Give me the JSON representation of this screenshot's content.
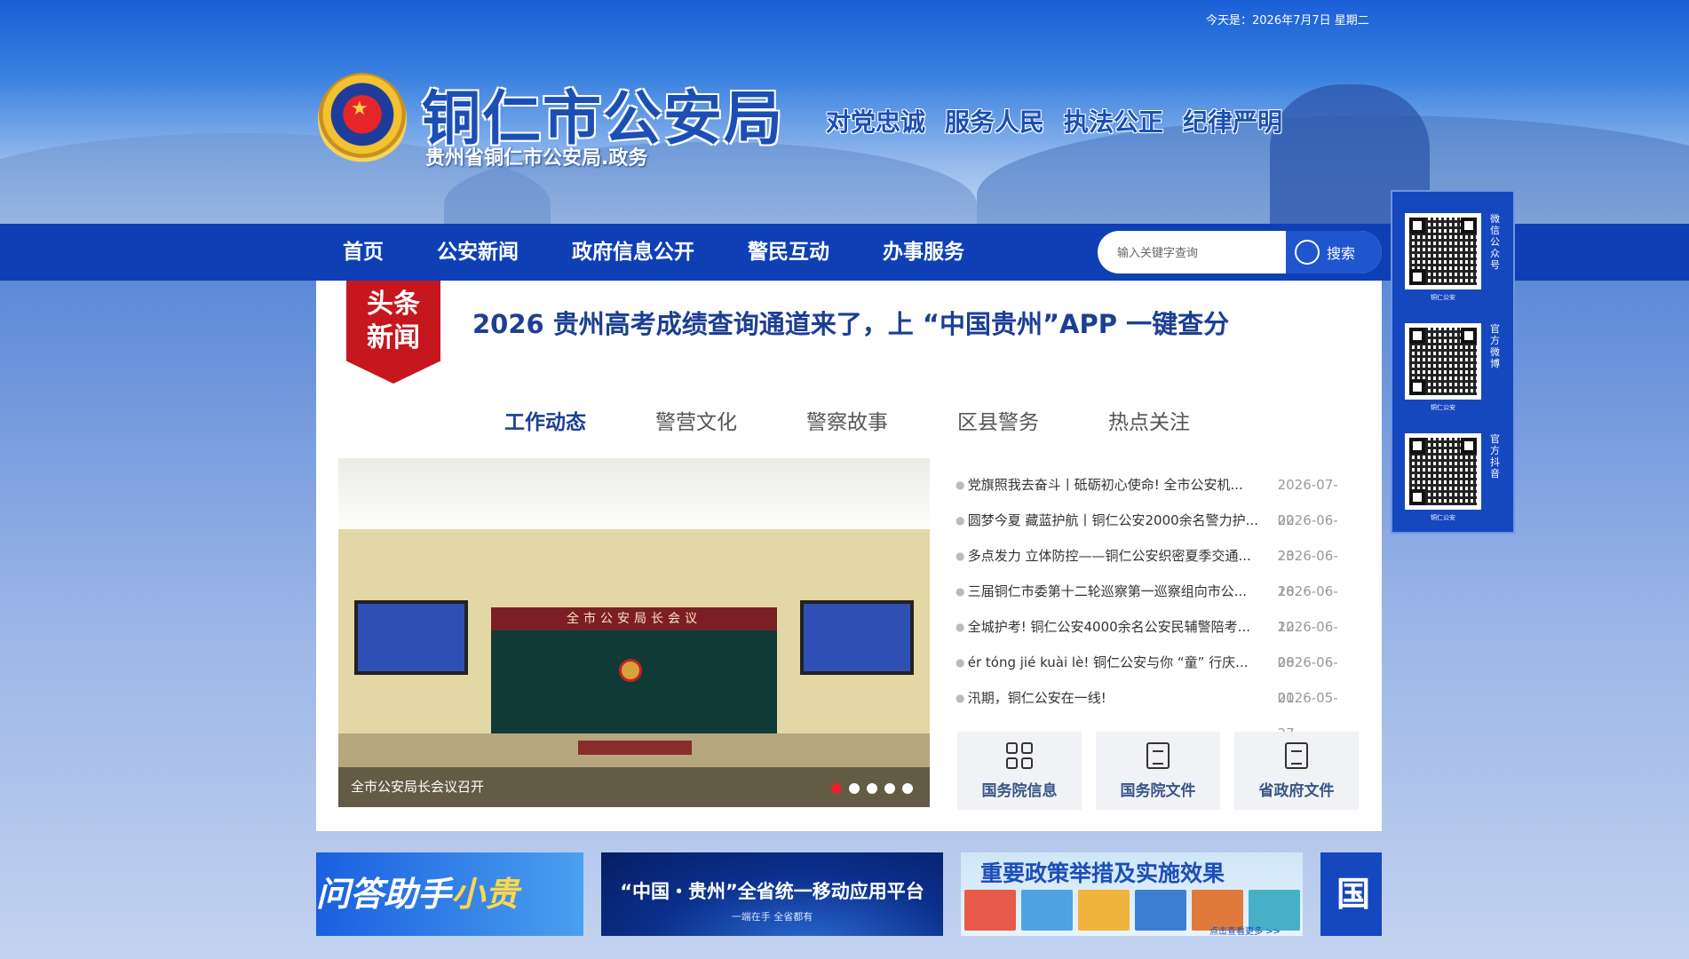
{
  "header": {
    "date": "今天是：2026年7月7日  星期二",
    "title": "铜仁市公安局",
    "subtitle": "贵州省铜仁市公安局.政务",
    "motto": [
      "对党忠诚",
      "服务人民",
      "执法公正",
      "纪律严明"
    ]
  },
  "nav": {
    "items": [
      "首页",
      "公安新闻",
      "政府信息公开",
      "警民互动",
      "办事服务"
    ]
  },
  "search": {
    "placeholder": "输入关键字查询",
    "button": "搜索"
  },
  "qr_codes": [
    {
      "label": "微信公众号",
      "name": "铜仁公安"
    },
    {
      "label": "官方微博",
      "name": "铜仁公安"
    },
    {
      "label": "官方抖音",
      "name": "铜仁公安"
    }
  ],
  "headline": {
    "badge_line1": "头条",
    "badge_line2": "新闻",
    "text": "2026 贵州高考成绩查询通道来了，上 “中国贵州”APP 一键查分"
  },
  "tabs": [
    "工作动态",
    "警营文化",
    "警察故事",
    "区县警务",
    "热点关注"
  ],
  "active_tab": 0,
  "slider": {
    "caption": "全市公安局长会议召开",
    "banner_text": "全市公安局长会议",
    "dot_count": 5,
    "active_dot": 0
  },
  "news": [
    {
      "title": "党旗照我去奋斗丨砥砺初心使命! 全市公安机...",
      "date": "2026-07-02"
    },
    {
      "title": "圆梦今夏 藏蓝护航丨铜仁公安2000余名警力护...",
      "date": "2026-06-23"
    },
    {
      "title": "多点发力 立体防控——铜仁公安织密夏季交通...",
      "date": "2026-06-18"
    },
    {
      "title": "三届铜仁市委第十二轮巡察第一巡察组向市公...",
      "date": "2026-06-12"
    },
    {
      "title": "全城护考! 铜仁公安4000余名公安民辅警陪考...",
      "date": "2026-06-08"
    },
    {
      "title": "ér tóng jié kuài lè! 铜仁公安与你 “童” 行庆...",
      "date": "2026-06-01"
    },
    {
      "title": "汛期，铜仁公安在一线!",
      "date": "2026-05-27"
    }
  ],
  "quick_links": [
    "国务院信息",
    "国务院文件",
    "省政府文件"
  ],
  "banners": {
    "b1_main": "问答助手",
    "b1_accent": "小贵",
    "b2_line1": "“中国・贵州”全省统一移动应用平台",
    "b2_line2": "一端在手  全省都有",
    "b3_title": "重要政策举措及实施效果",
    "b3_more": "点击查看更多 >>",
    "b4_text": "国"
  },
  "colors": {
    "nav_bg": "#0e3fb5",
    "headline": "#1c3f94",
    "badge": "#c5171d",
    "active_dot": "#e8222a"
  }
}
